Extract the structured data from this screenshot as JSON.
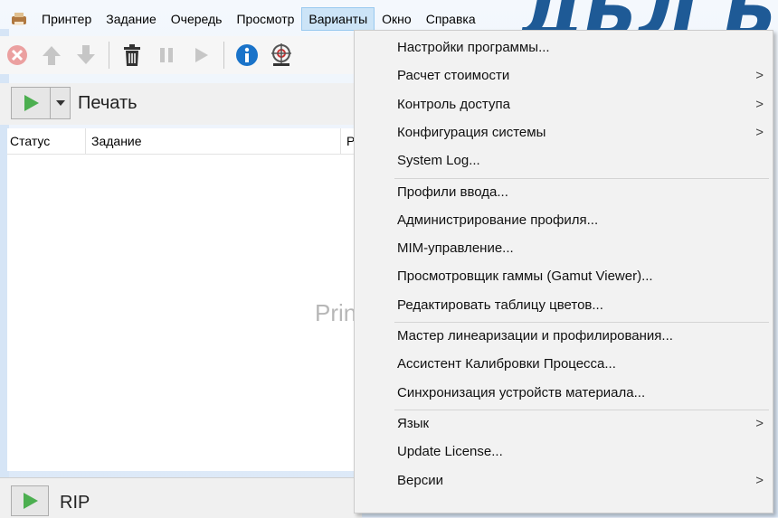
{
  "menubar": {
    "items": [
      "Принтер",
      "Задание",
      "Очередь",
      "Просмотр",
      "Варианты",
      "Окно",
      "Справка"
    ],
    "active": "Варианты"
  },
  "toolbar": {
    "icons": [
      "cancel-icon",
      "move-up-icon",
      "move-down-icon",
      "delete-icon",
      "pause-icon",
      "play-icon",
      "info-icon",
      "target-icon"
    ]
  },
  "queue": {
    "print_label": "Печать",
    "rip_label": "RIP"
  },
  "table": {
    "columns": [
      "Статус",
      "Задание",
      "Р"
    ],
    "placeholder": "Prin"
  },
  "dropdown": {
    "groups": [
      [
        {
          "label": "Настройки программы...",
          "submenu": false
        },
        {
          "label": "Расчет стоимости",
          "submenu": true
        },
        {
          "label": "Контроль доступа",
          "submenu": true
        },
        {
          "label": "Конфигурация системы",
          "submenu": true
        },
        {
          "label": "System Log...",
          "submenu": false
        }
      ],
      [
        {
          "label": "Профили ввода...",
          "submenu": false
        },
        {
          "label": "Администрирование профиля...",
          "submenu": false
        },
        {
          "label": "MIM-управление...",
          "submenu": false
        },
        {
          "label": "Просмотровщик гаммы (Gamut Viewer)...",
          "submenu": false
        },
        {
          "label": "Редактировать таблицу цветов...",
          "submenu": false
        }
      ],
      [
        {
          "label": "Мастер линеаризации и профилирования...",
          "submenu": false
        },
        {
          "label": "Ассистент Калибровки Процесса...",
          "submenu": false
        },
        {
          "label": "Синхронизация устройств материала...",
          "submenu": false
        }
      ],
      [
        {
          "label": "Язык",
          "submenu": true
        },
        {
          "label": "Update License...",
          "submenu": false
        },
        {
          "label": "Версии",
          "submenu": true
        }
      ]
    ],
    "submenu_arrow": ">"
  },
  "colors": {
    "accent": "#1e5a96",
    "play_green": "#4caf50",
    "info_blue": "#1a73c9",
    "cancel_red": "#e8a0a0"
  }
}
